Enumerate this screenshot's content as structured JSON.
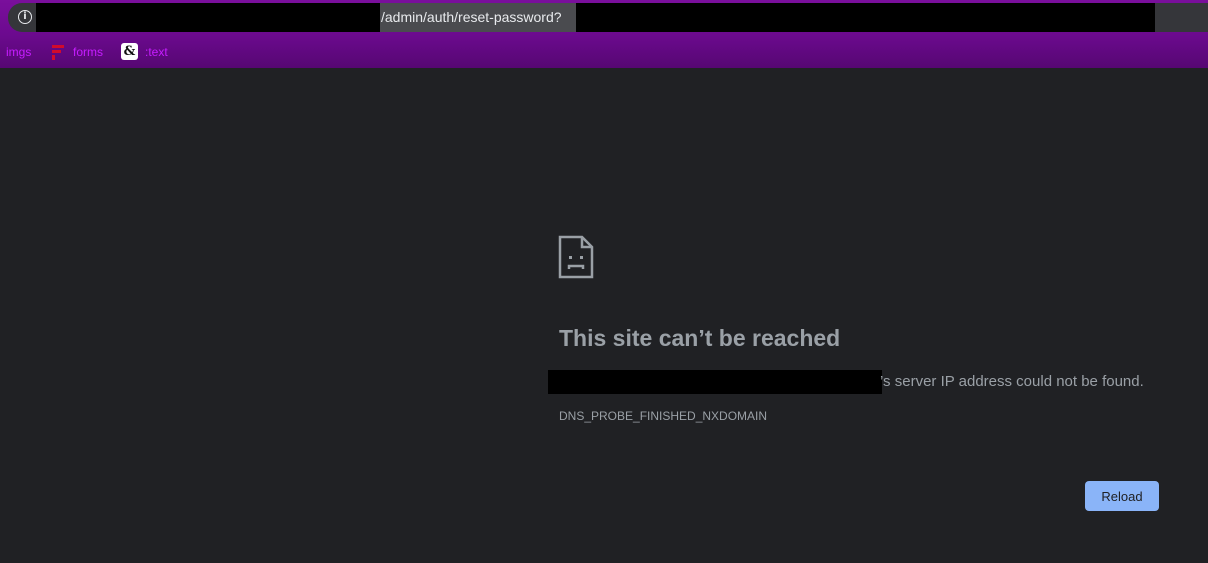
{
  "address_bar": {
    "url_path": "/admin/auth/reset-password?"
  },
  "bookmarks": [
    {
      "label": "imgs"
    },
    {
      "label": "forms"
    },
    {
      "label": ":text"
    }
  ],
  "bookmark_icon_text": "&",
  "error": {
    "title": "This site can’t be reached",
    "description_tail": "’s server IP address could not be found.",
    "code": "DNS_PROBE_FINISHED_NXDOMAIN",
    "reload_label": "Reload"
  },
  "colors": {
    "accent": "#8ab4f8",
    "bookmark_text": "#c61dff",
    "toolbar": "#6c0a8f",
    "background": "#202124"
  }
}
